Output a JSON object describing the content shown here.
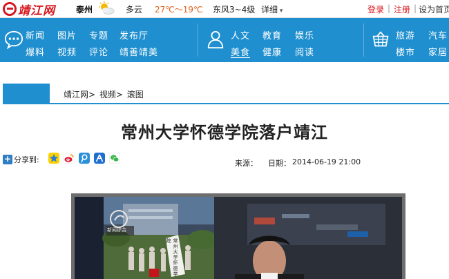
{
  "topbar": {
    "logo_text": "靖江网",
    "city": "泰州",
    "weather_icon": "sun-cloud-icon",
    "weather": "多云",
    "temperature": "27℃～19℃",
    "wind": "东风3~4级",
    "detail": "详细",
    "login": "登录",
    "separator": "|",
    "register": "注册",
    "set_home": "设为首页"
  },
  "nav": {
    "groups": [
      {
        "icon": "chat-bubble-icon",
        "rows": [
          [
            "新闻",
            "图片",
            "专题",
            "发布厅"
          ],
          [
            "爆料",
            "视频",
            "评论",
            "靖善靖美"
          ]
        ]
      },
      {
        "icon": "person-icon",
        "rows": [
          [
            "人文",
            "教育",
            "娱乐"
          ],
          [
            "美食",
            "健康",
            "阅读"
          ]
        ]
      },
      {
        "icon": "basket-icon",
        "rows": [
          [
            "旅游",
            "汽车"
          ],
          [
            "楼市",
            "家居"
          ]
        ]
      }
    ],
    "active_item": "美食"
  },
  "breadcrumb": {
    "items": [
      "靖江网>",
      "视频>",
      "滚图"
    ]
  },
  "article": {
    "title": "常州大学怀德学院落户靖江",
    "share_label": "分享到:",
    "share_icons": [
      "qzone-icon",
      "weibo-icon",
      "tencent-weibo-icon",
      "renren-icon",
      "wechat-icon"
    ],
    "source_label": "来源：",
    "date_label": "日期：",
    "date": "2014-06-19 21:00"
  },
  "video": {
    "channel_tag": "新闻综合",
    "caption": "常州大学怀德学院"
  },
  "colors": {
    "brand_red": "#d71920",
    "nav_blue": "#1f8fcf",
    "temp_orange": "#e0601a"
  }
}
